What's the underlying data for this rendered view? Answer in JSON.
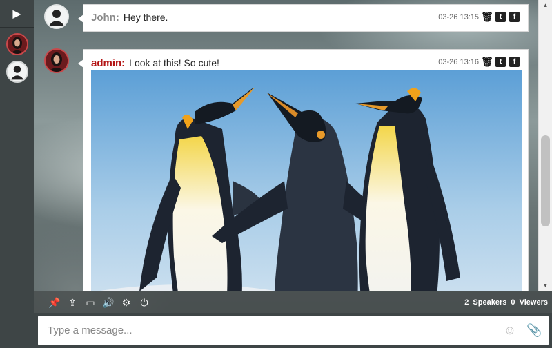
{
  "sidebar": {
    "toggle_icon": "play-icon"
  },
  "messages": [
    {
      "sender": "John:",
      "role": "user",
      "text": "Hey there.",
      "time": "03-26 13:15"
    },
    {
      "sender": "admin:",
      "role": "admin",
      "text": "Look at this! So cute!",
      "time": "03-26 13:16",
      "image": "penguins-photo"
    }
  ],
  "message_actions": {
    "trash_glyph": "🗑",
    "twitter_glyph": "t",
    "facebook_glyph": "f"
  },
  "toolbar": {
    "tools": [
      "pin-icon",
      "upload-icon",
      "window-icon",
      "volume-icon",
      "settings-icon",
      "power-icon"
    ],
    "speakers_count": "2",
    "speakers_label": "Speakers",
    "viewers_count": "0",
    "viewers_label": "Viewers"
  },
  "input": {
    "placeholder": "Type a message..."
  },
  "colors": {
    "admin_name": "#b31313",
    "user_name": "#8a8a8a",
    "sidebar_bg": "#3e4546"
  }
}
